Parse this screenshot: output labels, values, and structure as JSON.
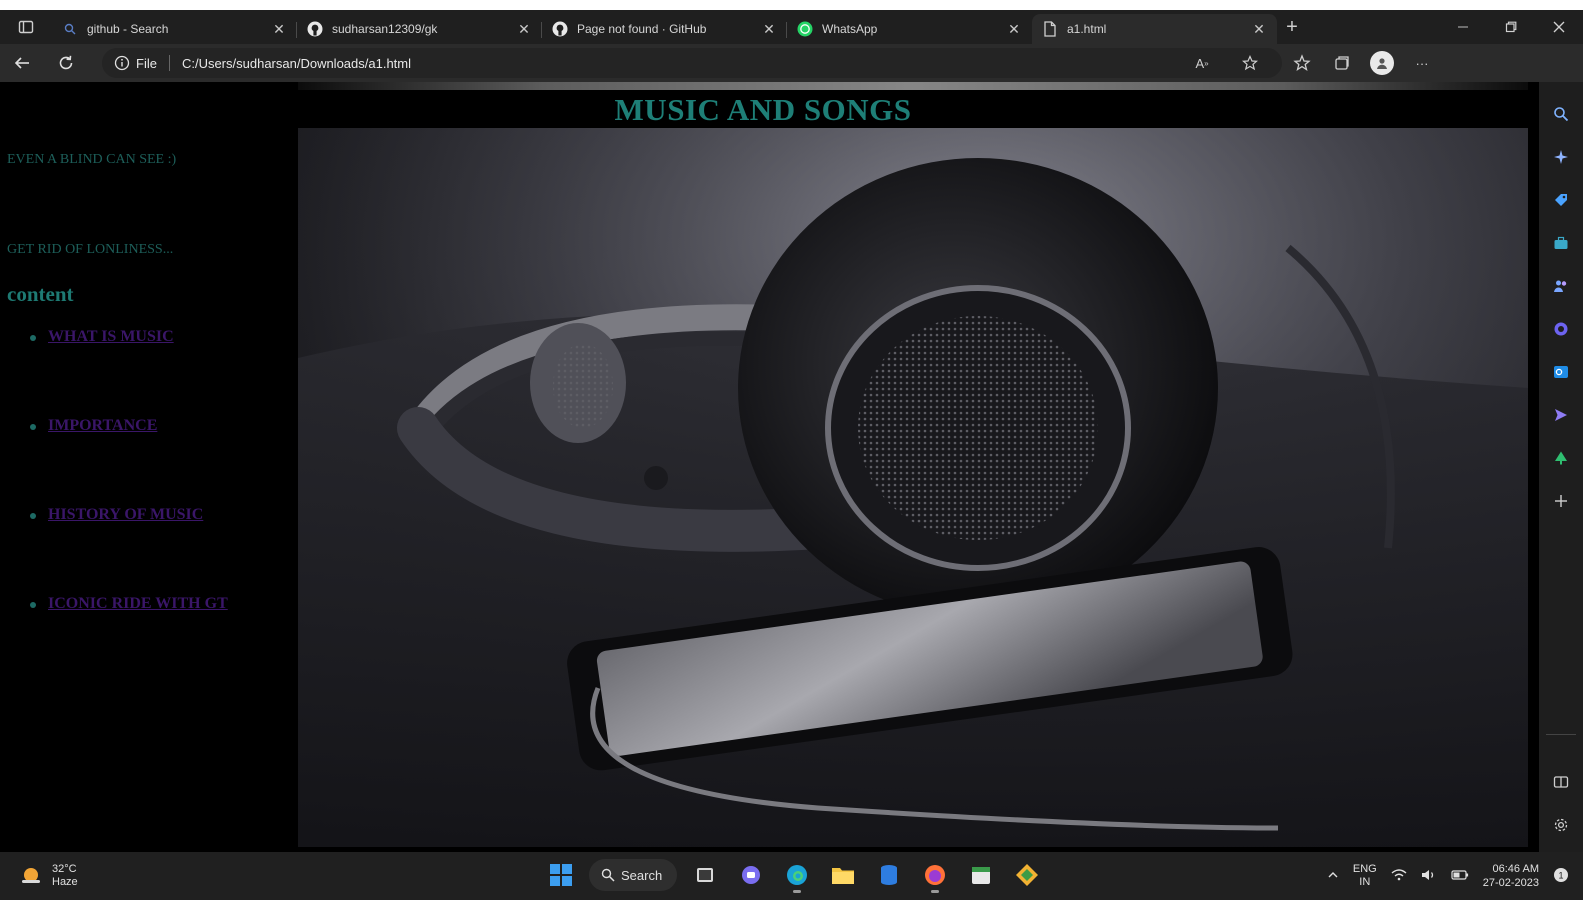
{
  "browser": {
    "tabs": [
      {
        "title": "github - Search",
        "icon": "search-icon",
        "active": false
      },
      {
        "title": "sudharsan12309/gk",
        "icon": "github-icon",
        "active": false
      },
      {
        "title": "Page not found · GitHub",
        "icon": "github-icon",
        "active": false
      },
      {
        "title": "WhatsApp",
        "icon": "whatsapp-icon",
        "active": false
      },
      {
        "title": "a1.html",
        "icon": "file-icon",
        "active": true
      }
    ],
    "address": {
      "scheme_label": "File",
      "url": "C:/Users/sudharsan/Downloads/a1.html"
    }
  },
  "page": {
    "title": "MUSIC AND SONGS",
    "tagline_1": "EVEN A BLIND CAN SEE :)",
    "tagline_2": "GET RID OF LONLINESS...",
    "content_heading": "content",
    "nav_links": [
      "WHAT IS MUSIC",
      "IMPORTANCE",
      "HISTORY OF MUSIC",
      "ICONIC RIDE WITH GT"
    ],
    "colors": {
      "title": "#1e7f77",
      "link": "#3a1668",
      "background": "#000000"
    }
  },
  "taskbar": {
    "weather_temp": "32°C",
    "weather_desc": "Haze",
    "search_label": "Search",
    "lang_1": "ENG",
    "lang_2": "IN",
    "time": "06:46 AM",
    "date": "27-02-2023"
  }
}
